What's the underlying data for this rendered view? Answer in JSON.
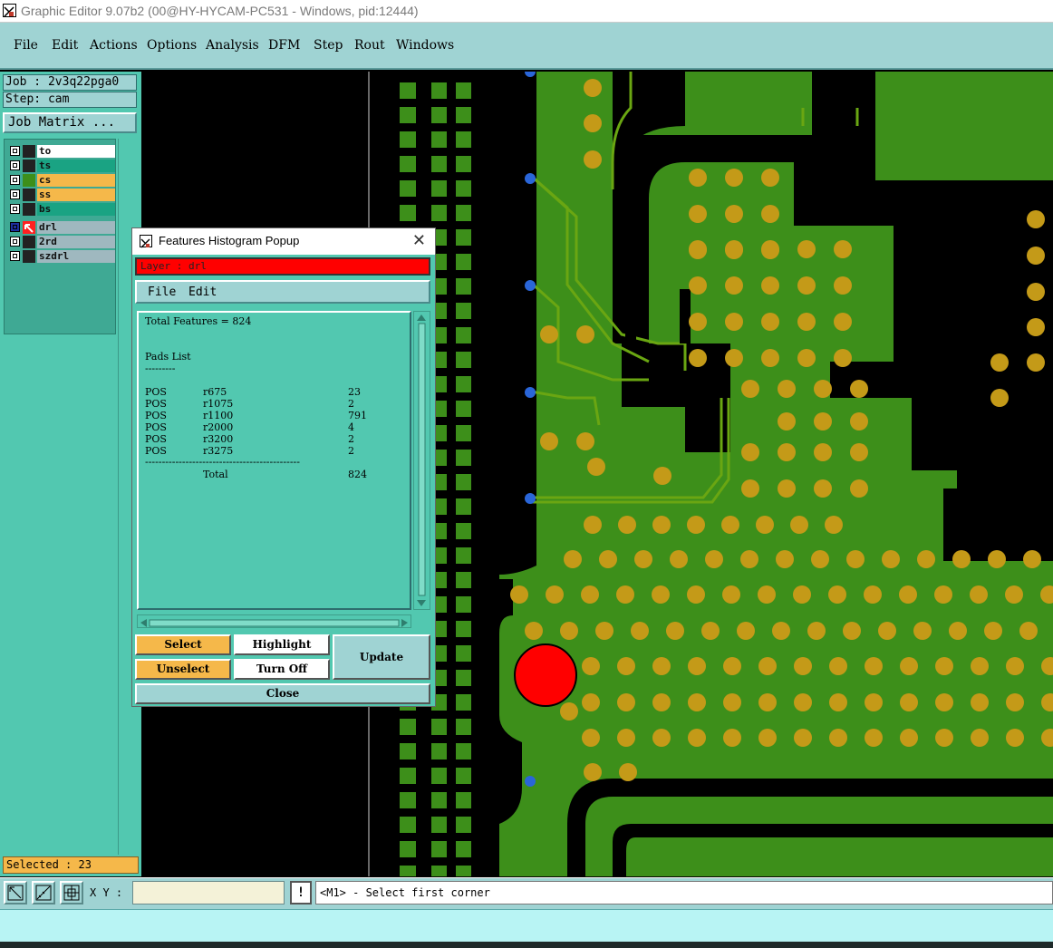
{
  "window": {
    "title": "Graphic Editor 9.07b2 (00@HY-HYCAM-PC531 - Windows, pid:12444)"
  },
  "menubar": [
    "File",
    "Edit",
    "Actions",
    "Options",
    "Analysis",
    "DFM",
    "Step",
    "Rout",
    "Windows"
  ],
  "job": {
    "job_text": "Job : 2v3q22pga0",
    "step_text": "Step: cam",
    "matrix_label": "Job Matrix ..."
  },
  "layers": [
    {
      "name": "to",
      "color": "#ffffff"
    },
    {
      "name": "ts",
      "color": "#1aa383"
    },
    {
      "name": "cs",
      "color": "#f5b84a"
    },
    {
      "name": "ss",
      "color": "#f5b84a"
    },
    {
      "name": "bs",
      "color": "#1aa383"
    },
    {
      "name": "drl",
      "color": "#9fb8bf"
    },
    {
      "name": "2rd",
      "color": "#9fb8bf"
    },
    {
      "name": "szdrl",
      "color": "#9fb8bf"
    }
  ],
  "selected_text": "Selected : 23",
  "popup": {
    "title": "Features Histogram Popup",
    "close_glyph": "✕",
    "layer_text": "Layer :  drl",
    "menu": [
      "File",
      "Edit"
    ],
    "total_line": "Total Features = 824",
    "pads_heading": "Pads List",
    "pads_underline": "---------",
    "rows": [
      {
        "pol": "POS",
        "sym": "r675",
        "count": "23"
      },
      {
        "pol": "POS",
        "sym": "r1075",
        "count": "2"
      },
      {
        "pol": "POS",
        "sym": "r1100",
        "count": "791"
      },
      {
        "pol": "POS",
        "sym": "r2000",
        "count": "4"
      },
      {
        "pol": "POS",
        "sym": "r3200",
        "count": "2"
      },
      {
        "pol": "POS",
        "sym": "r3275",
        "count": "2"
      }
    ],
    "divider": "----------------------------------------------",
    "total_label": "Total",
    "total_value": "824",
    "buttons": {
      "select": "Select",
      "highlight": "Highlight",
      "update": "Update",
      "unselect": "Unselect",
      "turn_off": "Turn Off",
      "close": "Close"
    }
  },
  "bottom": {
    "xy_label": "X Y :",
    "xy_value": "",
    "msg_icon": "!",
    "message": "<M1> - Select first corner"
  },
  "colors": {
    "board": "#3d8f1a",
    "copper_trace": "#6aa612",
    "pad": "#c49a18",
    "drill_red": "#ff0000",
    "via_blue": "#2a66d9",
    "teal": "#52c8b0",
    "menu": "#9fd3d3",
    "orange": "#f5b84a"
  },
  "icons": [
    "app-icon",
    "zoom-icon",
    "measure-icon",
    "snap-grid-icon",
    "close-icon",
    "message-icon"
  ]
}
